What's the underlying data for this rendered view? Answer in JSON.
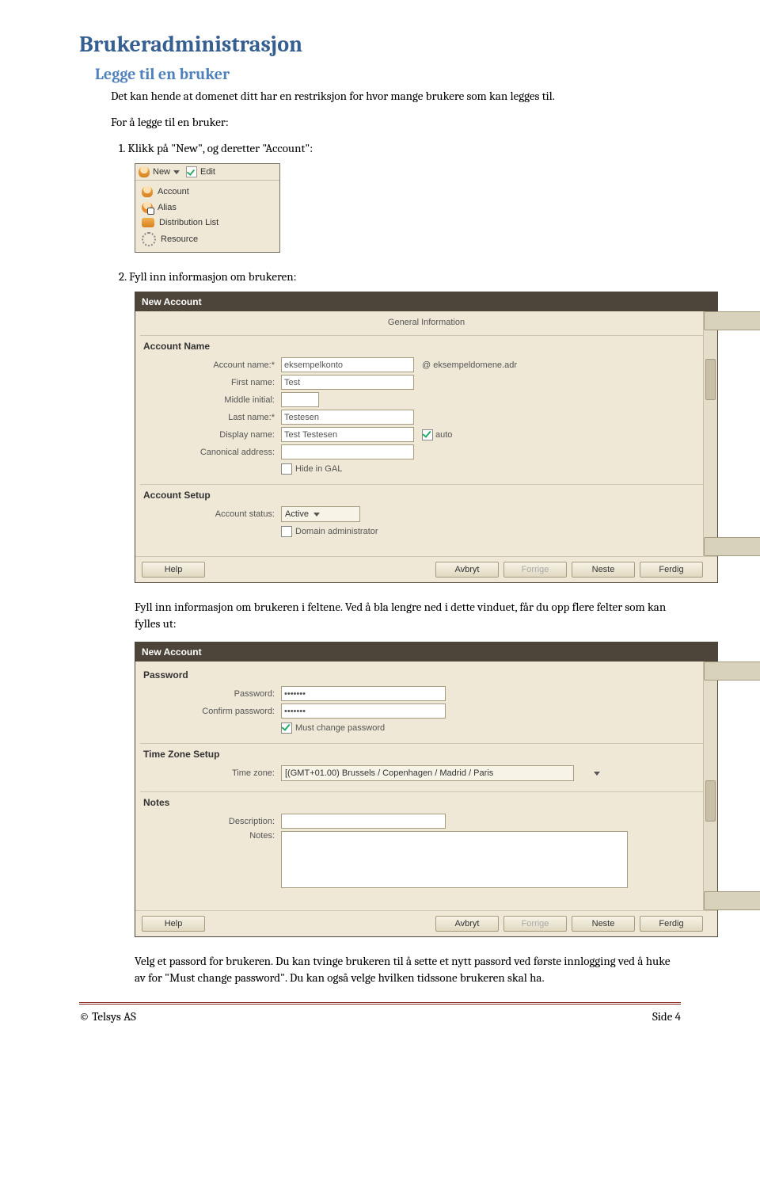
{
  "h1": "Brukeradministrasjon",
  "section1": {
    "h2": "Legge til en bruker",
    "intro": "Det kan hende at domenet ditt har en restriksjon for hvor mange brukere som kan legges til.",
    "intro2": "For å legge til en bruker:",
    "step1": "1. Klikk på \"New\", og deretter \"Account\":",
    "step2": "2. Fyll inn informasjon om brukeren:",
    "after2": "Fyll inn informasjon om brukeren i feltene. Ved å bla lengre ned i dette vinduet, får du opp flere felter som kan fylles ut:",
    "after3": "Velg et passord for brukeren. Du kan tvinge brukeren til å sette et nytt passord ved første innlogging ved å huke av for \"Must change password\". Du kan også velge hvilken tidssone brukeren skal ha."
  },
  "shot1": {
    "toolbar": {
      "new": "New",
      "edit": "Edit"
    },
    "menu": {
      "account": "Account",
      "alias": "Alias",
      "dlist": "Distribution List",
      "resource": "Resource"
    }
  },
  "dialog2": {
    "title": "New Account",
    "heading": "General Information",
    "acctname_sec": "Account Name",
    "labels": {
      "acctname": "Account name:*",
      "firstname": "First name:",
      "middle": "Middle initial:",
      "lastname": "Last name:*",
      "display": "Display name:",
      "canonical": "Canonical address:",
      "hidegal": "Hide in GAL",
      "acctstatus": "Account status:",
      "domainadmin": "Domain administrator",
      "auto": "auto"
    },
    "vals": {
      "acctname": "eksempelkonto",
      "domain": "@  eksempeldomene.adr",
      "firstname": "Test",
      "lastname": "Testesen",
      "display": "Test Testesen",
      "acctstatus": "Active"
    },
    "setup_sec": "Account Setup",
    "buttons": {
      "help": "Help",
      "avbryt": "Avbryt",
      "forrige": "Forrige",
      "neste": "Neste",
      "ferdig": "Ferdig"
    }
  },
  "dialog3": {
    "title": "New Account",
    "pw_sec": "Password",
    "labels": {
      "password": "Password:",
      "confirm": "Confirm password:",
      "mustchange": "Must change password",
      "tz": "Time zone:",
      "desc": "Description:",
      "notes": "Notes:"
    },
    "vals": {
      "password": "•••••••",
      "confirm": "•••••••",
      "tz": "[(GMT+01.00) Brussels / Copenhagen / Madrid / Paris"
    },
    "tz_sec": "Time Zone Setup",
    "notes_sec": "Notes",
    "buttons": {
      "help": "Help",
      "avbryt": "Avbryt",
      "forrige": "Forrige",
      "neste": "Neste",
      "ferdig": "Ferdig"
    }
  },
  "footer": {
    "left": "© Telsys AS",
    "right": "Side 4"
  }
}
